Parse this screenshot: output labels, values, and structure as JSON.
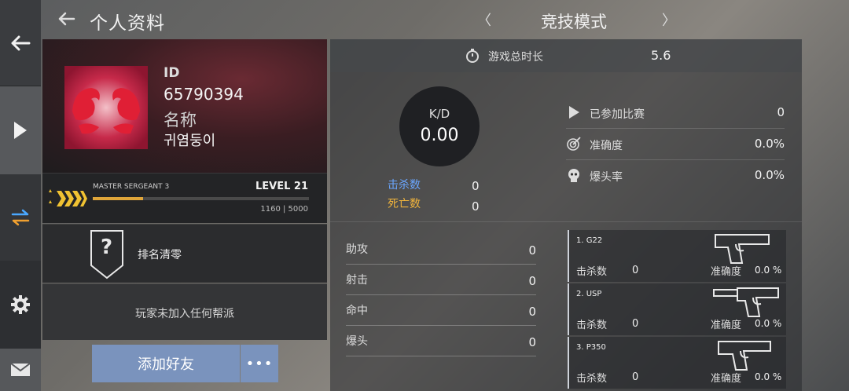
{
  "header": {
    "title": "个人资料",
    "mode_title": "竞技模式",
    "mode_prev_glyph": "〈",
    "mode_next_glyph": "〉"
  },
  "rail": {
    "icons": [
      "back-arrow-icon",
      "play-icon",
      "swap-icon",
      "gear-icon",
      "mail-icon"
    ]
  },
  "profile": {
    "id_label": "ID",
    "id_value": "65790394",
    "name_label": "名称",
    "name_value": "귀염둥이"
  },
  "rank": {
    "name": "MASTER SERGEANT 3",
    "level": "LEVEL 21",
    "xp_text": "1160 | 5000",
    "xp_fraction": 0.232
  },
  "ranking": {
    "shield_glyph": "?",
    "reset_label": "排名清零"
  },
  "clan": {
    "text": "玩家未加入任何帮派"
  },
  "actions": {
    "add_friend": "添加好友",
    "more": "•••"
  },
  "stats": {
    "playtime_label": "游戏总时长",
    "playtime_value": "5.6",
    "kd_label": "K/D",
    "kd_value": "0.00",
    "kills_label": "击杀数",
    "kills_value": "0",
    "deaths_label": "死亡数",
    "deaths_value": "0",
    "matches_label": "已参加比赛",
    "matches_value": "0",
    "accuracy_label": "准确度",
    "accuracy_value": "0.0%",
    "headshot_rate_label": "爆头率",
    "headshot_rate_value": "0.0%",
    "assists_label": "助攻",
    "assists_value": "0",
    "shots_label": "射击",
    "shots_value": "0",
    "hits_label": "命中",
    "hits_value": "0",
    "headshots_label": "爆头",
    "headshots_value": "0"
  },
  "weapons": [
    {
      "name": "1. G22",
      "kills_label": "击杀数",
      "kills_value": "0",
      "acc_label": "准确度",
      "acc_value": "0.0 %"
    },
    {
      "name": "2. USP",
      "kills_label": "击杀数",
      "kills_value": "0",
      "acc_label": "准确度",
      "acc_value": "0.0 %"
    },
    {
      "name": "3. P350",
      "kills_label": "击杀数",
      "kills_value": "0",
      "acc_label": "准确度",
      "acc_value": "0.0 %"
    }
  ],
  "colors": {
    "kills_label": "#6aa6ff",
    "deaths_label": "#f0b43c",
    "add_friend_bg": "#7a93bd",
    "xp_fill": "#e0a63a"
  }
}
